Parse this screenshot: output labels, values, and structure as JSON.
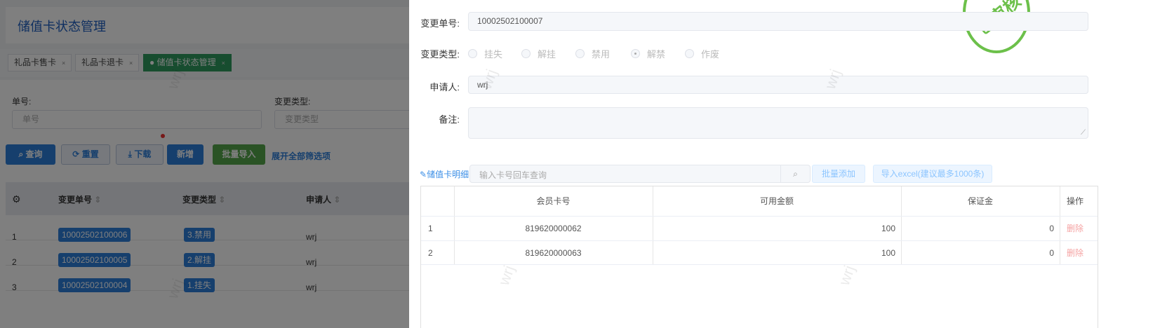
{
  "page": {
    "title": "储值卡状态管理",
    "tabs": [
      {
        "label": "礼品卡售卡",
        "close": "×"
      },
      {
        "label": "礼品卡退卡",
        "close": "×"
      },
      {
        "label": "储值卡状态管理",
        "close": "×"
      }
    ],
    "filters": {
      "order_label": "单号:",
      "order_placeholder": "单号",
      "type_label": "变更类型:",
      "type_placeholder": "变更类型"
    },
    "buttons": {
      "query": "查询",
      "reset": "重置",
      "download": "下载",
      "add": "新增",
      "batch_import": "批量导入",
      "expand": "展开全部筛选项"
    },
    "table": {
      "headers": [
        "变更单号",
        "变更类型",
        "申请人"
      ],
      "rows": [
        {
          "idx": "1",
          "no": "10002502100006",
          "type": "3.禁用",
          "applicant": "wrj"
        },
        {
          "idx": "2",
          "no": "10002502100005",
          "type": "2.解挂",
          "applicant": "wrj"
        },
        {
          "idx": "3",
          "no": "10002502100004",
          "type": "1.挂失",
          "applicant": "wrj"
        }
      ]
    },
    "watermark": "wrj"
  },
  "drawer": {
    "stamp": "已审核",
    "order_label": "变更单号:",
    "order_value": "10002502100007",
    "type_label": "变更类型:",
    "type_options": [
      {
        "label": "挂失",
        "checked": false
      },
      {
        "label": "解挂",
        "checked": false
      },
      {
        "label": "禁用",
        "checked": false
      },
      {
        "label": "解禁",
        "checked": true
      },
      {
        "label": "作废",
        "checked": false
      }
    ],
    "applicant_label": "申请人:",
    "applicant_value": "wrj",
    "remark_label": "备注:",
    "remark_value": "",
    "detail_label": "储值卡明细",
    "search_placeholder": "输入卡号回车查询",
    "batch_add": "批量添加",
    "import_excel": "导入excel(建议最多1000条)",
    "table": {
      "headers": [
        "",
        "会员卡号",
        "可用金额",
        "保证金",
        "操作"
      ],
      "rows": [
        {
          "idx": "1",
          "card": "819620000062",
          "amount": "100",
          "deposit": "0",
          "action": "删除"
        },
        {
          "idx": "2",
          "card": "819620000063",
          "amount": "100",
          "deposit": "0",
          "action": "删除"
        }
      ]
    }
  }
}
